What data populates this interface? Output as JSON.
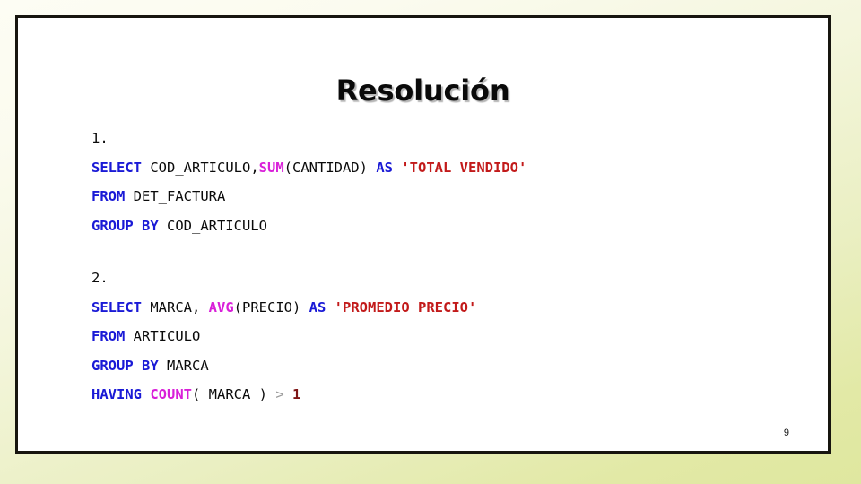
{
  "slide": {
    "title": "Resolución",
    "page_number": "9",
    "colors": {
      "keyword": "#1a1ad6",
      "function": "#d91fd9",
      "string": "#c21a1a",
      "plain": "#0a0a0a",
      "operator": "#9a9a9a",
      "number": "#7e1515",
      "slide_background": "#ffffff",
      "slide_border": "#17150f",
      "page_background_top": "#fdfdf4",
      "page_background_bottom": "#dfe79f"
    },
    "code_blocks": [
      {
        "marker": "1.",
        "lines": [
          {
            "tokens": [
              {
                "text": "SELECT",
                "type": "keyword"
              },
              {
                "text": " COD_ARTICULO,",
                "type": "plain"
              },
              {
                "text": "SUM",
                "type": "function"
              },
              {
                "text": "(CANTIDAD) ",
                "type": "plain"
              },
              {
                "text": "AS",
                "type": "keyword"
              },
              {
                "text": " ",
                "type": "plain"
              },
              {
                "text": "'TOTAL VENDIDO'",
                "type": "string"
              }
            ]
          },
          {
            "tokens": [
              {
                "text": "FROM",
                "type": "keyword"
              },
              {
                "text": " DET_FACTURA",
                "type": "plain"
              }
            ]
          },
          {
            "tokens": [
              {
                "text": "GROUP BY",
                "type": "keyword"
              },
              {
                "text": " COD_ARTICULO",
                "type": "plain"
              }
            ]
          }
        ]
      },
      {
        "marker": "2.",
        "lines": [
          {
            "tokens": [
              {
                "text": "SELECT",
                "type": "keyword"
              },
              {
                "text": " MARCA, ",
                "type": "plain"
              },
              {
                "text": "AVG",
                "type": "function"
              },
              {
                "text": "(PRECIO) ",
                "type": "plain"
              },
              {
                "text": "AS",
                "type": "keyword"
              },
              {
                "text": " ",
                "type": "plain"
              },
              {
                "text": "'PROMEDIO PRECIO'",
                "type": "string"
              }
            ]
          },
          {
            "tokens": [
              {
                "text": "FROM",
                "type": "keyword"
              },
              {
                "text": " ARTICULO",
                "type": "plain"
              }
            ]
          },
          {
            "tokens": [
              {
                "text": "GROUP BY",
                "type": "keyword"
              },
              {
                "text": " MARCA",
                "type": "plain"
              }
            ]
          },
          {
            "tokens": [
              {
                "text": "HAVING",
                "type": "keyword"
              },
              {
                "text": " ",
                "type": "plain"
              },
              {
                "text": "COUNT",
                "type": "function"
              },
              {
                "text": "( MARCA ) ",
                "type": "plain"
              },
              {
                "text": ">",
                "type": "operator"
              },
              {
                "text": " ",
                "type": "plain"
              },
              {
                "text": "1",
                "type": "number"
              }
            ]
          }
        ]
      }
    ]
  }
}
